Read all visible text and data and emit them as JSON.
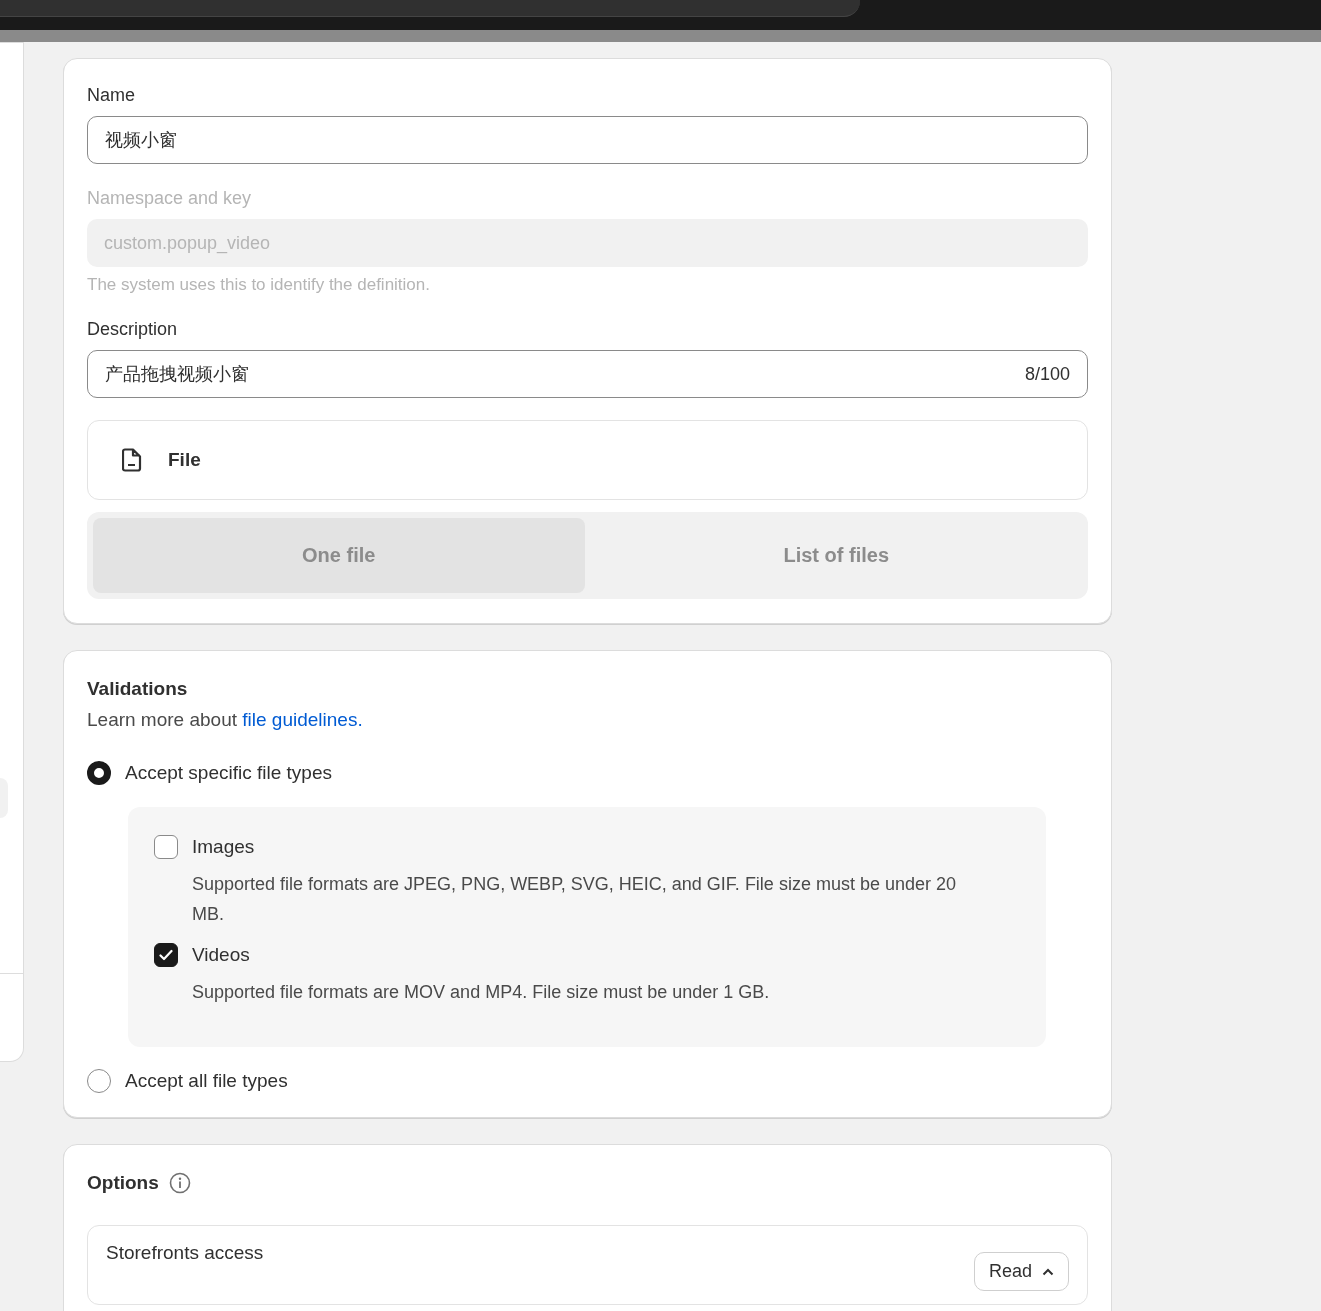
{
  "definition": {
    "name": {
      "label": "Name",
      "value": "视频小窗"
    },
    "namespace": {
      "label": "Namespace and key",
      "value": "custom.popup_video",
      "help": "The system uses this to identify the definition.",
      "disabled": true
    },
    "description": {
      "label": "Description",
      "value": "产品拖拽视频小窗",
      "count": "8/100"
    },
    "type": {
      "label": "File"
    },
    "cardinality": [
      {
        "label": "One file",
        "selected": true,
        "disabled": true
      },
      {
        "label": "List of files",
        "selected": false,
        "disabled": true
      }
    ]
  },
  "validations": {
    "title": "Validations",
    "intro": "Learn more about ",
    "link": "file guidelines.",
    "options": [
      {
        "label": "Accept specific file types",
        "selected": true,
        "types": [
          {
            "label": "Images",
            "checked": false,
            "help": "Supported file formats are JPEG, PNG, WEBP, SVG, HEIC, and GIF. File size must be under 20 MB."
          },
          {
            "label": "Videos",
            "checked": true,
            "help": "Supported file formats are MOV and MP4. File size must be under 1 GB."
          }
        ]
      },
      {
        "label": "Accept all file types",
        "selected": false
      }
    ]
  },
  "options": {
    "title": "Options",
    "rows": [
      {
        "label": "Storefronts access",
        "value": "Read"
      }
    ]
  }
}
